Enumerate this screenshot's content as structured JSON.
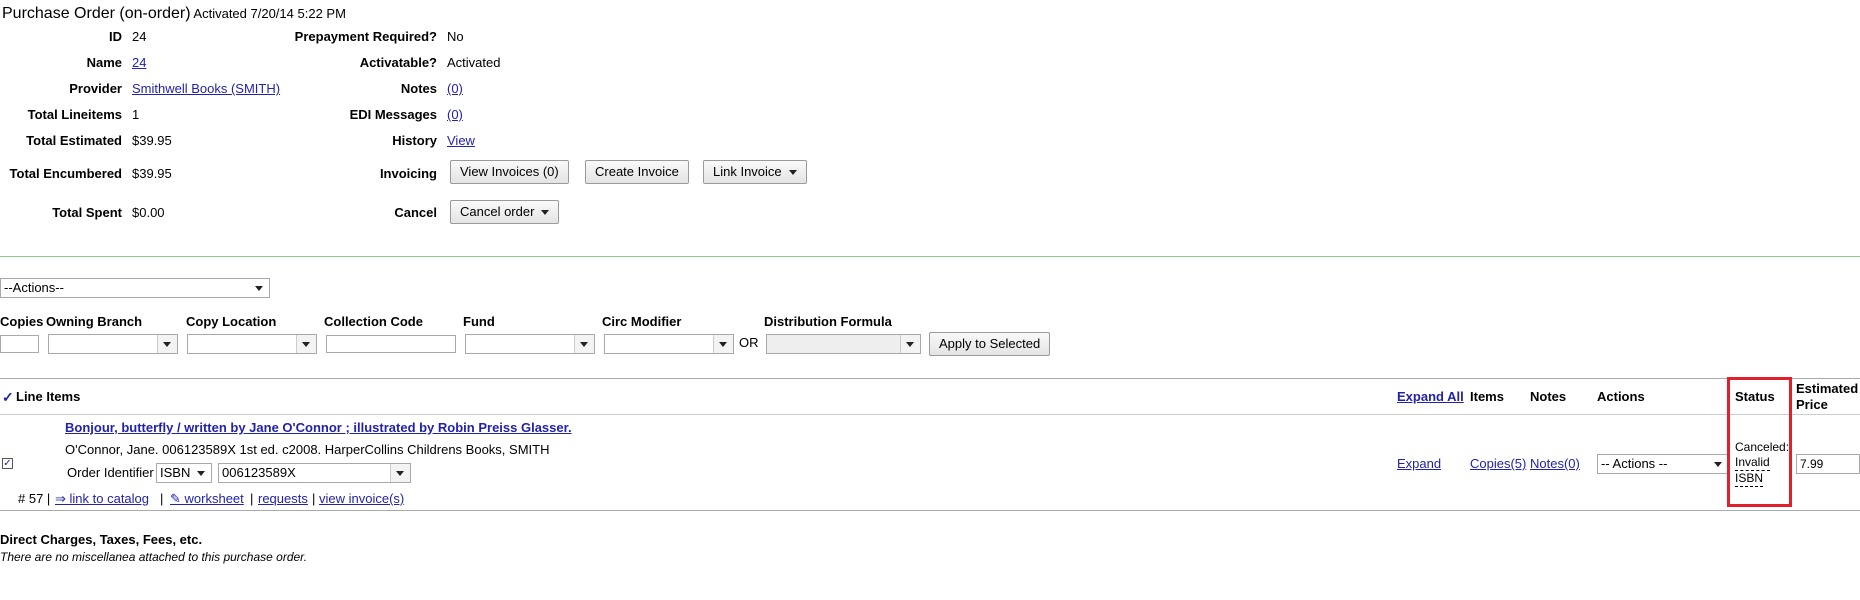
{
  "header": {
    "title": "Purchase Order (on-order)",
    "activated": "Activated 7/20/14 5:22 PM"
  },
  "left_fields": [
    {
      "label": "ID",
      "value": "24",
      "link": false
    },
    {
      "label": "Name",
      "value": "24",
      "link": true
    },
    {
      "label": "Provider",
      "value": "Smithwell Books (SMITH)",
      "link": true
    },
    {
      "label": "Total Lineitems",
      "value": "1",
      "link": false
    },
    {
      "label": "Total Estimated",
      "value": "$39.95",
      "link": false
    },
    {
      "label": "Total Encumbered",
      "value": "$39.95",
      "link": false
    },
    {
      "label": "Total Spent",
      "value": "$0.00",
      "link": false
    }
  ],
  "right_fields": [
    {
      "label": "Prepayment Required?",
      "value": "No"
    },
    {
      "label": "Activatable?",
      "value": "Activated"
    },
    {
      "label": "Notes",
      "value": "(0)"
    },
    {
      "label": "EDI Messages",
      "value": "(0)"
    },
    {
      "label": "History",
      "value": "View"
    }
  ],
  "invoicing": {
    "label": "Invoicing",
    "view_invoices": "View Invoices (0)",
    "create_invoice": "Create Invoice",
    "link_invoice": "Link Invoice"
  },
  "cancel": {
    "label": "Cancel",
    "button": "Cancel order"
  },
  "actions_select": "--Actions--",
  "batch": {
    "copies": "Copies",
    "owning_branch": "Owning Branch",
    "copy_location": "Copy Location",
    "collection_code": "Collection Code",
    "fund": "Fund",
    "circ_modifier": "Circ Modifier",
    "or": "OR",
    "distribution_formula": "Distribution Formula",
    "apply": "Apply to Selected"
  },
  "table_header": {
    "check": "✓",
    "line_items": "Line Items",
    "expand_all": "Expand All",
    "items": "Items",
    "notes": "Notes",
    "actions": "Actions",
    "status": "Status",
    "estimated_price_1": "Estimated",
    "estimated_price_2": "Price"
  },
  "line_item": {
    "title": "Bonjour, butterfly / written by Jane O'Connor ; illustrated by Robin Preiss Glasser.",
    "details": "O'Connor, Jane. 006123589X 1st ed. c2008. HarperCollins Childrens Books, SMITH",
    "order_identifier_label": "Order Identifier",
    "identifier_type": "ISBN",
    "identifier_value": "006123589X",
    "number": "# 57 |",
    "link_catalog": "link to catalog",
    "worksheet": "worksheet",
    "requests": "requests",
    "view_invoices": "view invoice(s)",
    "sep": "|",
    "expand": "Expand",
    "copies": "Copies(5)",
    "notes": "Notes(0)",
    "actions": "-- Actions --",
    "status_1": "Canceled:",
    "status_2": "Invalid",
    "status_3": "ISBN",
    "price": "7.99"
  },
  "charges": {
    "title": "Direct Charges, Taxes, Fees, etc.",
    "empty": "There are no miscellanea attached to this purchase order."
  },
  "colors": {
    "highlight": "#e0202a",
    "link": "#2222aa",
    "green_rule": "#8fc98f"
  }
}
